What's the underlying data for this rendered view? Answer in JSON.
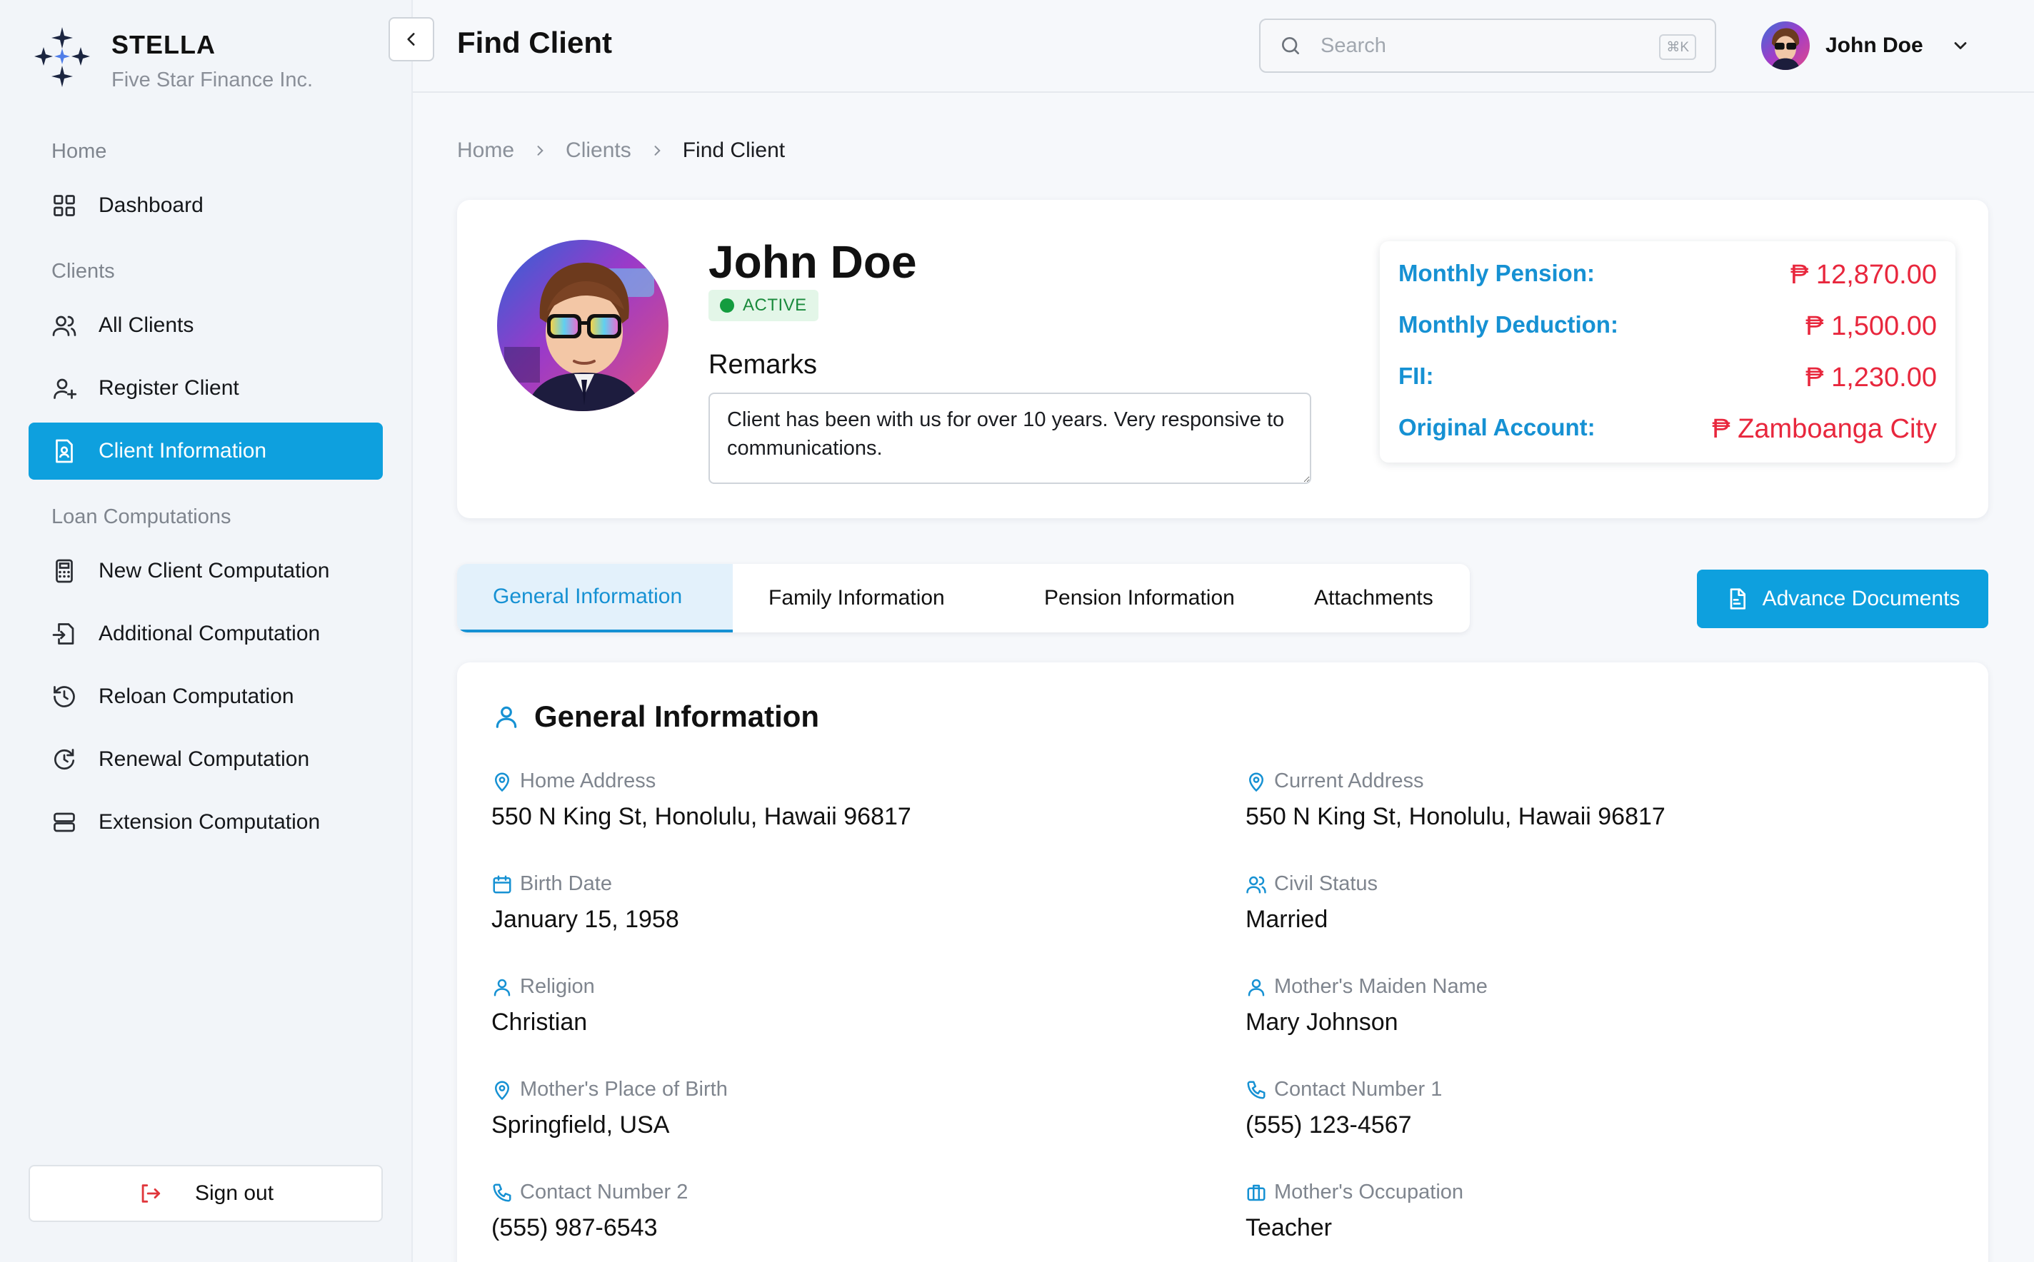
{
  "brand": {
    "name": "STELLA",
    "subtitle": "Five Star Finance Inc."
  },
  "sidebar": {
    "sections": [
      {
        "title": "Home",
        "items": [
          {
            "label": "Dashboard",
            "icon": "dashboard-grid-icon"
          }
        ]
      },
      {
        "title": "Clients",
        "items": [
          {
            "label": "All Clients",
            "icon": "users-icon"
          },
          {
            "label": "Register Client",
            "icon": "user-plus-icon"
          },
          {
            "label": "Client Information",
            "icon": "id-document-icon",
            "active": true
          }
        ]
      },
      {
        "title": "Loan Computations",
        "items": [
          {
            "label": "New Client Computation",
            "icon": "calculator-icon"
          },
          {
            "label": "Additional Computation",
            "icon": "file-import-icon"
          },
          {
            "label": "Reloan Computation",
            "icon": "history-icon"
          },
          {
            "label": "Renewal Computation",
            "icon": "clock-refresh-icon"
          },
          {
            "label": "Extension Computation",
            "icon": "server-stack-icon"
          }
        ]
      }
    ],
    "signout_label": "Sign out"
  },
  "header": {
    "title": "Find Client",
    "search_placeholder": "Search",
    "search_shortcut": "⌘K",
    "user_name": "John Doe"
  },
  "breadcrumb": [
    "Home",
    "Clients",
    "Find Client"
  ],
  "profile": {
    "name": "John Doe",
    "status": "ACTIVE",
    "remarks_label": "Remarks",
    "remarks": "Client has been with us for over 10 years. Very responsive to communications.",
    "financials": [
      {
        "label": "Monthly Pension:",
        "value": "₱ 12,870.00"
      },
      {
        "label": "Monthly Deduction:",
        "value": "₱ 1,500.00"
      },
      {
        "label": "FII:",
        "value": "₱ 1,230.00"
      },
      {
        "label": "Original Account:",
        "value": "₱ Zamboanga City"
      }
    ]
  },
  "tabs": [
    "General Information",
    "Family Information",
    "Pension Information",
    "Attachments"
  ],
  "advance_documents_label": "Advance Documents",
  "general_info": {
    "title": "General Information",
    "fields": [
      {
        "label": "Home Address",
        "value": "550 N King St, Honolulu, Hawaii 96817",
        "icon": "map-pin-icon"
      },
      {
        "label": "Current Address",
        "value": "550 N King St, Honolulu, Hawaii 96817",
        "icon": "map-pin-icon"
      },
      {
        "label": "Birth Date",
        "value": "January 15, 1958",
        "icon": "calendar-icon"
      },
      {
        "label": "Civil Status",
        "value": "Married",
        "icon": "users-icon"
      },
      {
        "label": "Religion",
        "value": "Christian",
        "icon": "user-icon"
      },
      {
        "label": "Mother's Maiden Name",
        "value": "Mary Johnson",
        "icon": "user-icon"
      },
      {
        "label": "Mother's Place of Birth",
        "value": "Springfield, USA",
        "icon": "map-pin-icon"
      },
      {
        "label": "Contact Number 1",
        "value": "(555) 123-4567",
        "icon": "phone-icon"
      },
      {
        "label": "Contact Number 2",
        "value": "(555) 987-6543",
        "icon": "phone-icon"
      },
      {
        "label": "Mother's Occupation",
        "value": "Teacher",
        "icon": "briefcase-icon"
      }
    ]
  },
  "colors": {
    "accent": "#0ea0de",
    "label_blue": "#1691d3",
    "money_red": "#e8273d",
    "status_green": "#149c3f",
    "sidebar_bg": "#f2f5f9"
  }
}
